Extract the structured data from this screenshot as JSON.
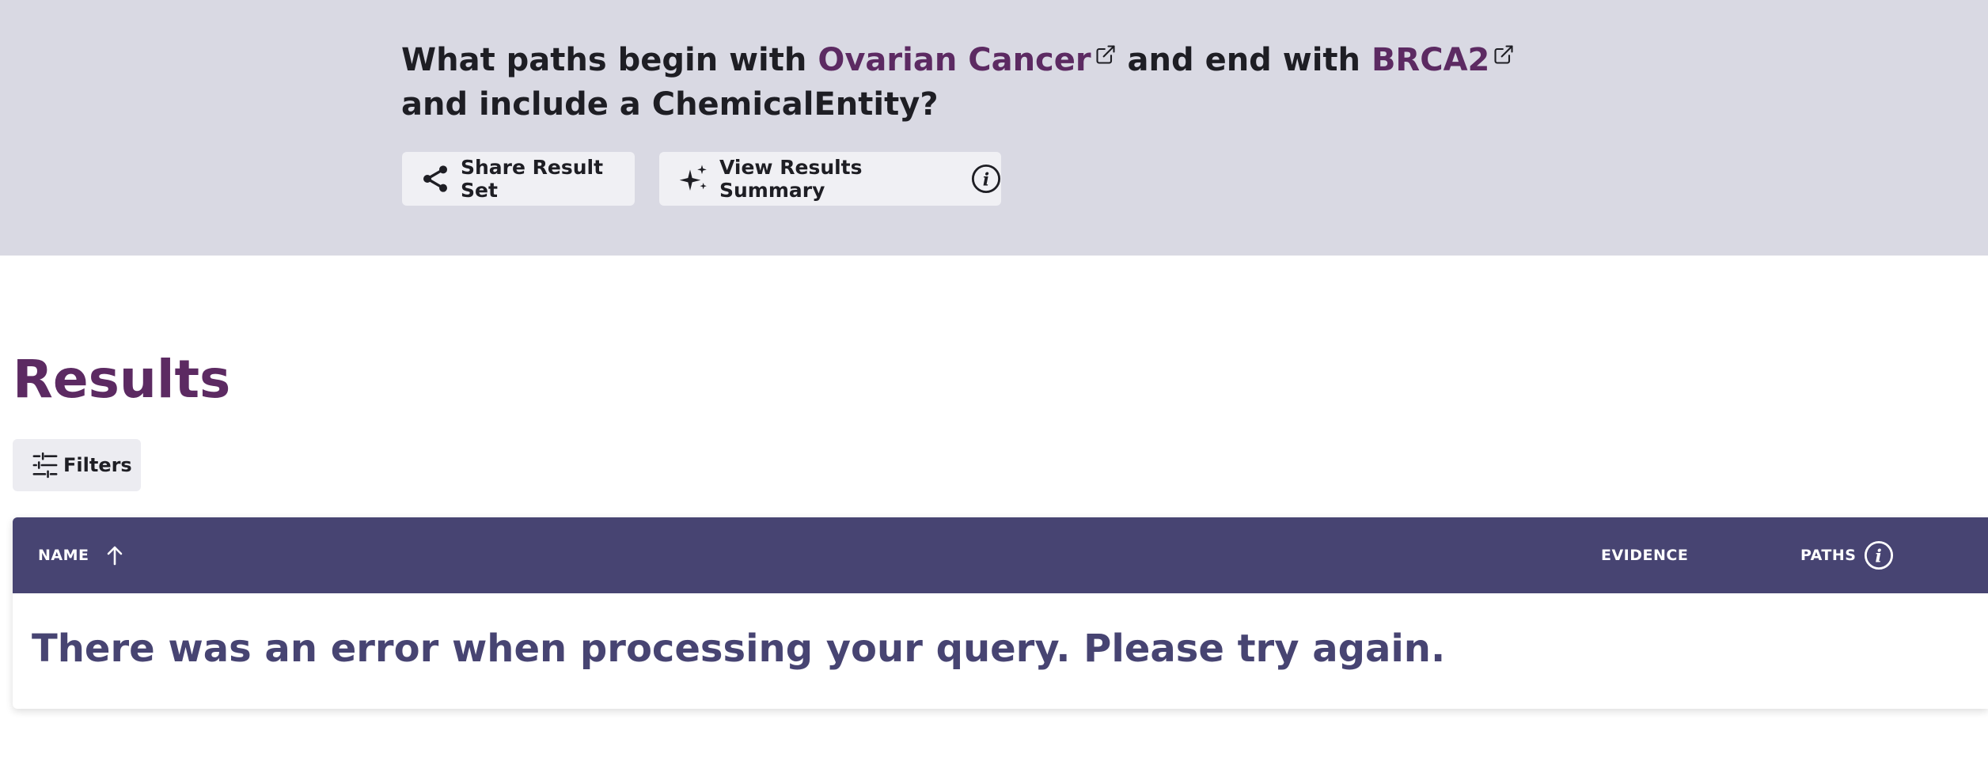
{
  "query": {
    "prefix": "What paths begin with",
    "start_entity": "Ovarian Cancer",
    "middle": "and end with",
    "end_entity": "BRCA2",
    "suffix": "and include a ChemicalEntity?"
  },
  "actions": {
    "share_label": "Share Result Set",
    "summary_label": "View Results Summary"
  },
  "results": {
    "heading": "Results",
    "filters_label": "Filters"
  },
  "table": {
    "columns": {
      "name": "NAME",
      "evidence": "EVIDENCE",
      "paths": "PATHS"
    },
    "error_message": "There was an error when processing your query. Please try again."
  },
  "colors": {
    "banner_bg": "#d9d9e3",
    "entity_link": "#5c2a62",
    "table_header_bg": "#474472",
    "error_text": "#474472",
    "results_heading": "#5c2a62"
  },
  "icons": {
    "share": "share-icon",
    "summary": "sparkle-icon",
    "info": "info-icon",
    "external_link": "external-link-icon",
    "filters": "sliders-icon",
    "sort": "arrow-up-icon"
  }
}
